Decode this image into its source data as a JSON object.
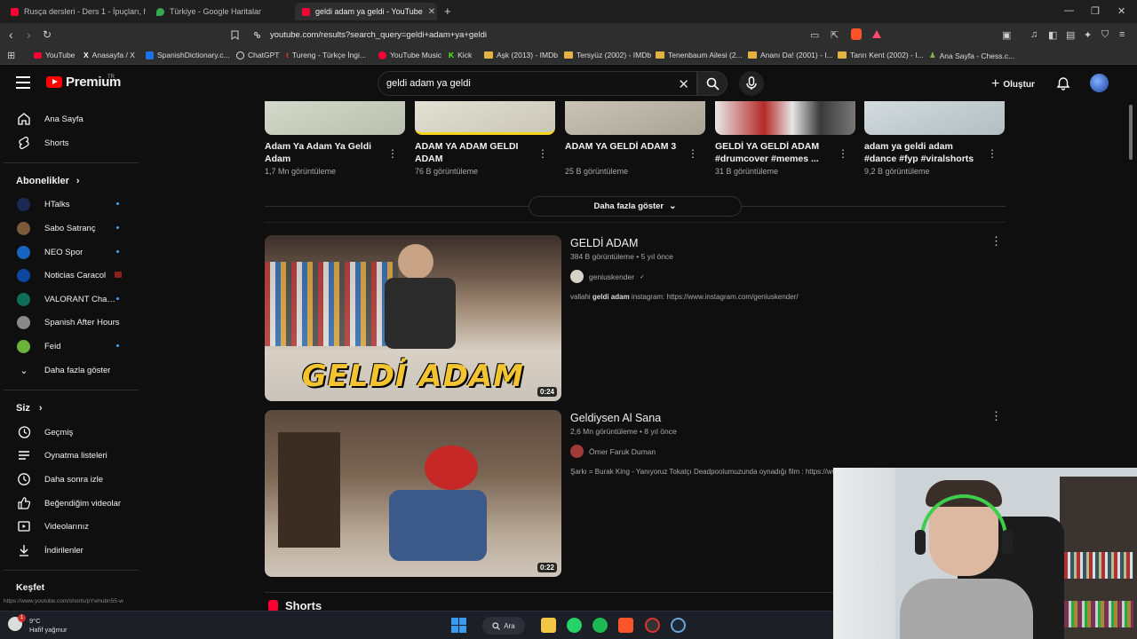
{
  "browser": {
    "tabs": [
      {
        "title": "Rusça dersleri - Ders 1 - İpuçları, hed",
        "favicon_color": "#ff0033"
      },
      {
        "title": "Türkiye - Google Haritalar",
        "favicon_color": "#34a853"
      },
      {
        "title": "geldi adam ya geldi - YouTube",
        "favicon_color": "#ff0033",
        "active": true
      }
    ],
    "new_tab": "+",
    "url": "youtube.com/results?search_query=geldi+adam+ya+geldi",
    "bookmarks": [
      {
        "label": "YouTube",
        "icon": "youtube-icon"
      },
      {
        "label": "Anasayfa / X",
        "icon": "x-icon"
      },
      {
        "label": "SpanishDictionary.c...",
        "icon": "sd-icon"
      },
      {
        "label": "ChatGPT",
        "icon": "chatgpt-icon"
      },
      {
        "label": "Tureng - Türkçe İngi...",
        "icon": "tureng-icon"
      },
      {
        "label": "YouTube Music",
        "icon": "ytmusic-icon"
      },
      {
        "label": "Kick",
        "icon": "kick-icon"
      },
      {
        "label": "Aşk (2013) - IMDb",
        "icon": "folder-icon"
      },
      {
        "label": "Tersyüz (2002) - IMDb",
        "icon": "folder-icon"
      },
      {
        "label": "Tenenbaum Ailesi (2...",
        "icon": "folder-icon"
      },
      {
        "label": "Ananı Da! (2001) - I...",
        "icon": "folder-icon"
      },
      {
        "label": "Tanrı Kent (2002) - I...",
        "icon": "folder-icon"
      },
      {
        "label": "Ana Sayfa - Chess.c...",
        "icon": "chess-icon"
      }
    ]
  },
  "header": {
    "logo": "Premium",
    "logo_region": "TR",
    "search_value": "geldi adam ya geldi",
    "create_label": "Oluştur"
  },
  "sidebar": {
    "top": [
      {
        "label": "Ana Sayfa",
        "icon": "home-icon"
      },
      {
        "label": "Shorts",
        "icon": "shorts-icon"
      }
    ],
    "subscriptions_title": "Abonelikler",
    "subscriptions": [
      {
        "label": "HTalks",
        "color": "#1b2a55",
        "dot": true
      },
      {
        "label": "Sabo Satranç",
        "color": "#7a5a3a",
        "dot": true
      },
      {
        "label": "NEO Spor",
        "color": "#1565c0",
        "dot": true
      },
      {
        "label": "Noticias Caracol",
        "color": "#0d47a1",
        "live": true
      },
      {
        "label": "VALORANT Chall...",
        "color": "#0f6e5a",
        "dot": true
      },
      {
        "label": "Spanish After Hours",
        "color": "#8a8a8a"
      },
      {
        "label": "Feid",
        "color": "#6bb33a",
        "dot": true
      }
    ],
    "show_more": "Daha fazla göster",
    "you_title": "Siz",
    "you_items": [
      {
        "label": "Geçmiş",
        "icon": "history-icon"
      },
      {
        "label": "Oynatma listeleri",
        "icon": "playlist-icon"
      },
      {
        "label": "Daha sonra izle",
        "icon": "clock-icon"
      },
      {
        "label": "Beğendiğim videolar",
        "icon": "like-icon"
      },
      {
        "label": "Videolarınız",
        "icon": "video-icon"
      },
      {
        "label": "İndirilenler",
        "icon": "download-icon"
      }
    ],
    "explore_title": "Keşfet",
    "status_url": "https://www.youtube.com/shorts/pYwhubn55-w"
  },
  "shorts_row": [
    {
      "title": "Adam Ya Adam Ya Geldi Adam",
      "views": "1,7 Mn görüntüleme",
      "thumb": "#c9cfc2"
    },
    {
      "title": "ADAM YA ADAM GELDI ADAM",
      "views": "76 B görüntüleme",
      "thumb": "#d8d6cc"
    },
    {
      "title": "ADAM YA GELDİ ADAM 3",
      "views": "25 B görüntüleme",
      "thumb": "#b8b4a8"
    },
    {
      "title": "GELDİ YA GELDİ ADAM #drumcover #memes ...",
      "views": "31 B görüntüleme",
      "thumb": "#8a3a3a"
    },
    {
      "title": "adam ya geldi adam #dance #fyp #viralshorts",
      "views": "9,2 B görüntüleme",
      "thumb": "#c4cdd0"
    }
  ],
  "show_more_label": "Daha fazla göster",
  "videos": [
    {
      "title": "GELDİ ADAM",
      "meta": "384 B görüntüleme • 5 yıl önce",
      "channel": "geniuskender",
      "verified": "✓",
      "desc_prefix": "vallahi ",
      "desc_bold": "geldi adam",
      "desc_rest": " instagram: https://www.instagram.com/geniuskender/",
      "duration": "0:24",
      "thumb_caption": "GELDİ ADAM"
    },
    {
      "title": "Geldiysen Al Sana",
      "meta": "2,6 Mn görüntüleme • 8 yıl önce",
      "channel": "Ömer Faruk Duman",
      "desc": "Şarkı = Burak King - Yanıyoruz Tokatçı Deadpoolumuzunda oynadığı film : https://ww",
      "duration": "0:22"
    }
  ],
  "shorts_section_title": "Shorts",
  "taskbar": {
    "temp": "9°C",
    "weather": "Hafif yağmur",
    "search_label": "Ara",
    "badge": "1"
  }
}
